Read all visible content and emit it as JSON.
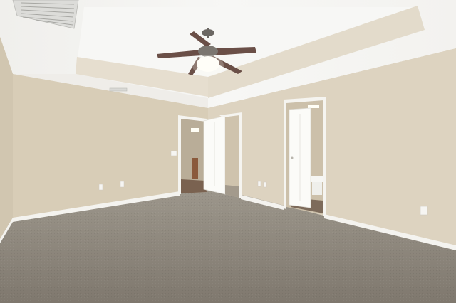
{
  "scene": {
    "colors": {
      "ceiling": "#f4f4f2",
      "tray": "#e7dfd1",
      "wall_left": "#d7ccb6",
      "wall_back": "#dfd6c4",
      "wall_right": "#d9cfbb",
      "carpet": "#8c857b",
      "trim": "#f7f7f4",
      "door": "#fbfbf8",
      "fan_blade": "#6a4f47",
      "fan_metal": "#6b6762",
      "light": "#fffef8",
      "floor_wood": "#7a6250"
    },
    "icons": [
      "ceiling-fan-icon",
      "light-globe-icon",
      "air-vent-icon",
      "door-icon",
      "outlet-icon",
      "light-switch-icon",
      "toilet-icon"
    ]
  }
}
